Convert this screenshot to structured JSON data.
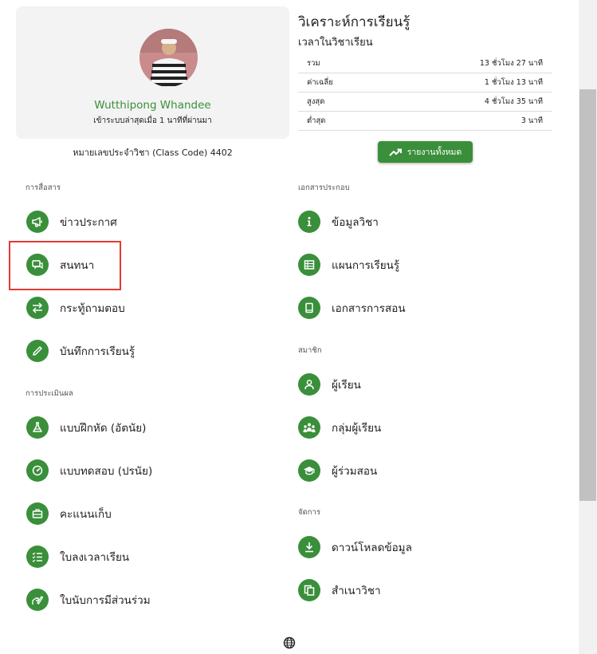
{
  "profile": {
    "name": "Wutthipong Whandee",
    "last_login": "เข้าระบบล่าสุดเมื่อ 1 นาทีที่ผ่านมา",
    "class_code": "หมายเลขประจำวิชา (Class Code) 4402"
  },
  "analytics": {
    "title": "วิเคราะห์การเรียนรู้",
    "subtitle": "เวลาในวิชาเรียน",
    "rows": [
      {
        "label": "รวม",
        "value": "13 ชั่วโมง 27 นาที"
      },
      {
        "label": "ค่าเฉลี่ย",
        "value": "1 ชั่วโมง 13 นาที"
      },
      {
        "label": "สูงสุด",
        "value": "4 ชั่วโมง 35 นาที"
      },
      {
        "label": "ต่ำสุด",
        "value": "3 นาที"
      }
    ],
    "report_button": "รายงานทั้งหมด"
  },
  "sections": {
    "communication": "การสื่อสาร",
    "assessment": "การประเมินผล",
    "documents": "เอกสารประกอบ",
    "members": "สมาชิก",
    "manage": "จัดการ"
  },
  "menu": {
    "announcements": "ข่าวประกาศ",
    "chat": "สนทนา",
    "qa": "กระทู้ถามตอบ",
    "learning_log": "บันทึกการเรียนรู้",
    "exercises": "แบบฝึกหัด (อัตนัย)",
    "quizzes": "แบบทดสอบ (ปรนัย)",
    "scores": "คะแนนเก็บ",
    "attendance": "ใบลงเวลาเรียน",
    "participation": "ใบนับการมีส่วนร่วม",
    "course_info": "ข้อมูลวิชา",
    "learning_plan": "แผนการเรียนรู้",
    "teaching_docs": "เอกสารการสอน",
    "students": "ผู้เรียน",
    "student_groups": "กลุ่มผู้เรียน",
    "co_teachers": "ผู้ร่วมสอน",
    "download": "ดาวน์โหลดข้อมูล",
    "copy_course": "สำเนาวิชา"
  },
  "colors": {
    "accent": "#3a8f3a",
    "highlight": "#e53935"
  }
}
